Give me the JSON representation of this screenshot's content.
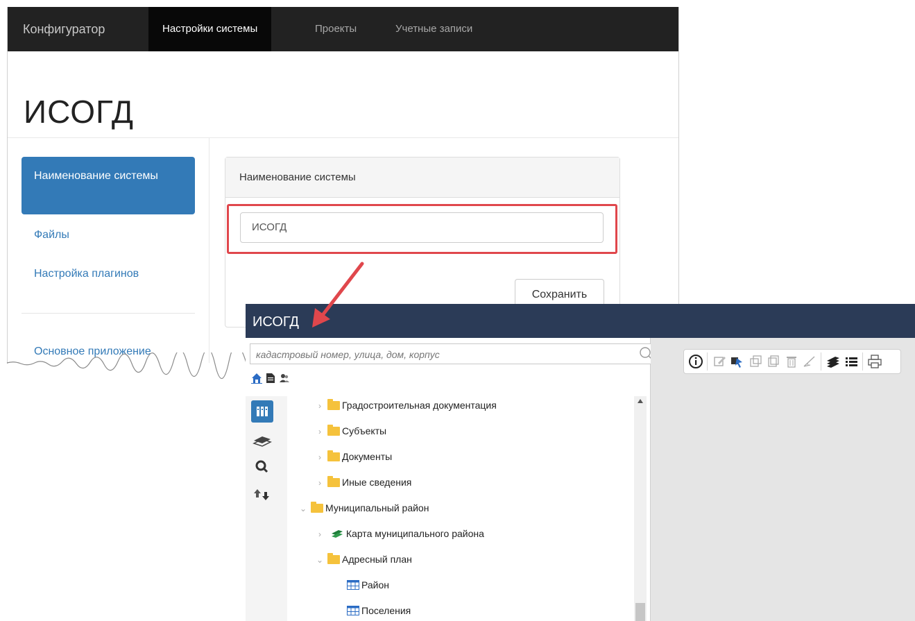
{
  "configurator": {
    "nav": {
      "brand": "Конфигуратор",
      "items": [
        "Настройки системы",
        "Проекты",
        "Учетные записи"
      ],
      "active_index": 0
    },
    "page_title": "ИСОГД",
    "sidebar": {
      "active": "Наименование системы",
      "links": [
        "Файлы",
        "Настройка плагинов"
      ],
      "section_link": "Основное приложение"
    },
    "panel": {
      "heading": "Наименование системы",
      "input_value": "ИСОГД",
      "save_label": "Сохранить"
    }
  },
  "app": {
    "title": "ИСОГД",
    "search_placeholder": "кадастровый номер, улица, дом, корпус",
    "tree": [
      {
        "label": "Градостроительная документация",
        "level": 1,
        "icon": "folder-icon",
        "expanded": false
      },
      {
        "label": "Субъекты",
        "level": 1,
        "icon": "folder-icon",
        "expanded": false
      },
      {
        "label": "Документы",
        "level": 1,
        "icon": "folder-icon",
        "expanded": false
      },
      {
        "label": "Иные сведения",
        "level": 1,
        "icon": "folder-icon",
        "expanded": false
      },
      {
        "label": "Муниципальный район",
        "level": 0,
        "icon": "folder-icon",
        "expanded": true
      },
      {
        "label": "Карта муниципального района",
        "level": 1,
        "icon": "layers-icon",
        "expanded": false
      },
      {
        "label": "Адресный план",
        "level": 1,
        "icon": "folder-icon",
        "expanded": true
      },
      {
        "label": "Район",
        "level": 2,
        "icon": "table-icon"
      },
      {
        "label": "Поселения",
        "level": 2,
        "icon": "table-icon"
      }
    ],
    "colors": {
      "header": "#2b3b57",
      "accent": "#337ab7",
      "highlight": "#e0474c",
      "folder": "#f5c23c"
    }
  }
}
